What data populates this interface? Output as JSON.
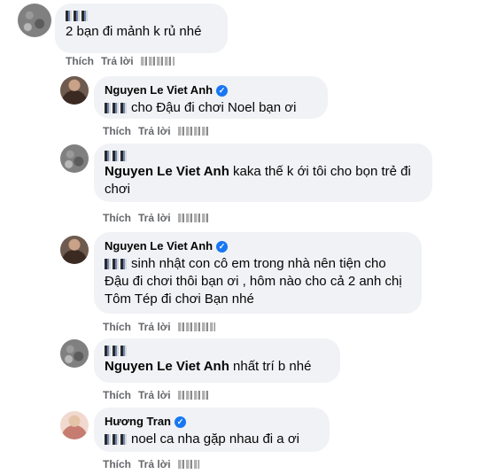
{
  "comments": [
    {
      "author": "",
      "text": "2 bạn đi mảnh k rủ nhé",
      "like": "Thích",
      "reply": "Trả lời"
    },
    {
      "author": "Nguyen Le Viet Anh",
      "text": "cho Đậu đi chơi Noel bạn ơi",
      "like": "Thích",
      "reply": "Trả lời"
    },
    {
      "author": "",
      "author_strong": "Nguyen Le Viet Anh",
      "text": "kaka thế k ới tôi cho bọn trẻ đi chơi",
      "like": "Thích",
      "reply": "Trả lời"
    },
    {
      "author": "Nguyen Le Viet Anh",
      "text": "sinh nhật con cô em trong nhà nên tiện cho Đậu đi chơi thôi bạn ơi , hôm nào cho cả 2 anh chị Tôm Tép đi chơi Bạn nhé",
      "like": "Thích",
      "reply": "Trả lời"
    },
    {
      "author": "",
      "author_strong": "Nguyen Le Viet Anh",
      "text": "nhất trí b nhé",
      "like": "Thích",
      "reply": "Trả lời"
    },
    {
      "author": "Hương Tran",
      "text": "noel ca nha gặp nhau đi a ơi",
      "like": "Thích",
      "reply": "Trả lời"
    }
  ]
}
